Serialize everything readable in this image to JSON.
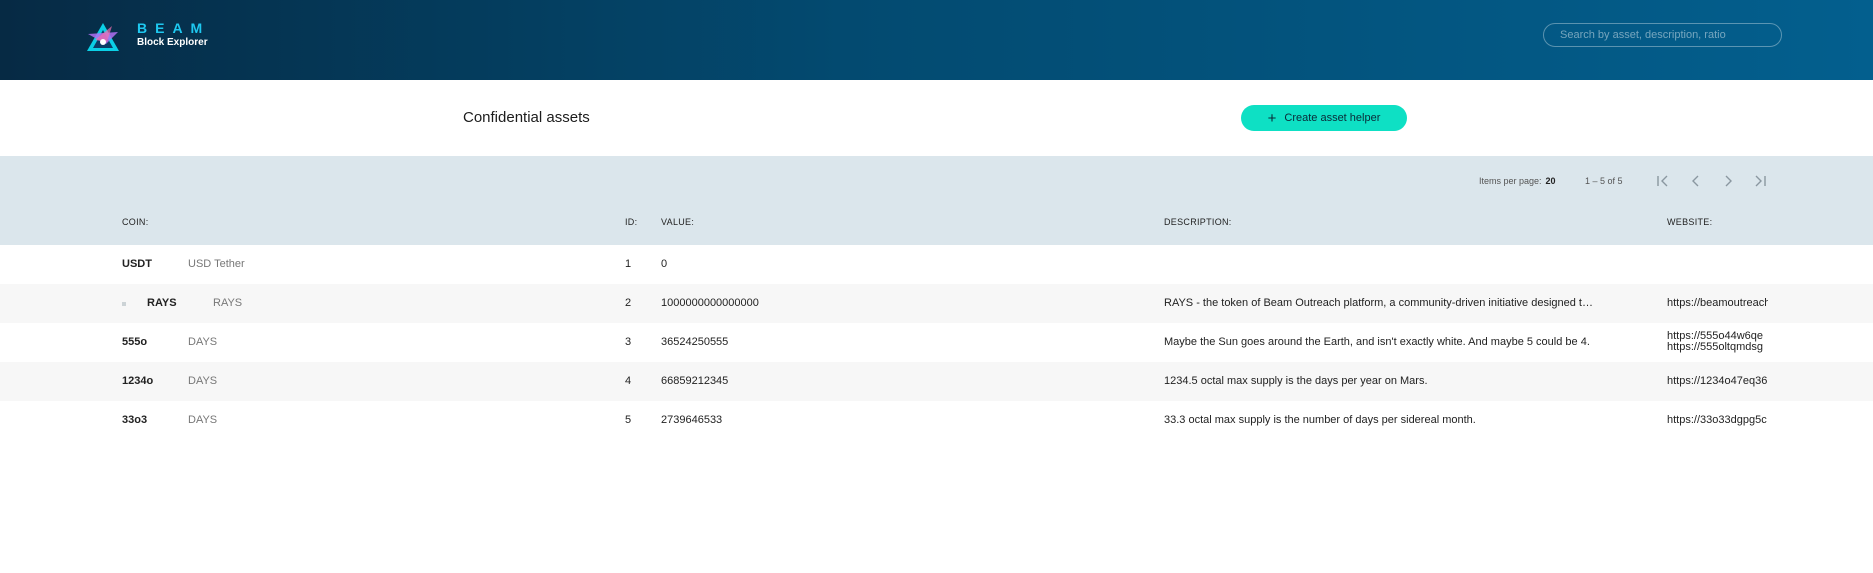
{
  "brand": {
    "name": "BEAM",
    "subtitle": "Block Explorer"
  },
  "search": {
    "placeholder": "Search by asset, description, ratio"
  },
  "page": {
    "title": "Confidential assets",
    "create_button": "Create asset helper"
  },
  "pagination": {
    "items_per_page_label": "Items per page:",
    "items_per_page": "20",
    "range": "1 – 5 of 5"
  },
  "columns": {
    "coin": "COIN:",
    "id": "ID:",
    "value": "VALUE:",
    "description": "DESCRIPTION:",
    "website": "WEBSITE:"
  },
  "rows": [
    {
      "coin": "USDT",
      "name": "USD Tether",
      "id": "1",
      "value": "0",
      "description": "",
      "website": ""
    },
    {
      "coin": "RAYS",
      "name": "RAYS",
      "id": "2",
      "value": "1000000000000000",
      "description": "RAYS - the token of Beam Outreach platform, a community-driven initiative designed to promote the Beam ecosystem",
      "website": "https://beamoutreach"
    },
    {
      "coin": "555o",
      "name": "DAYS",
      "id": "3",
      "value": "36524250555",
      "description": "Maybe the Sun goes around the Earth, and isn't exactly white. And maybe 5 could be 4.",
      "website": "https://555o44w6qe",
      "website2": "https://555oltqmdsg"
    },
    {
      "coin": "1234o",
      "name": "DAYS",
      "id": "4",
      "value": "66859212345",
      "description": "1234.5 octal max supply is the days per year on Mars.",
      "website": "https://1234o47eq36"
    },
    {
      "coin": "33o3",
      "name": "DAYS",
      "id": "5",
      "value": "2739646533",
      "description": "33.3 octal max supply is the number of days per sidereal month.",
      "website": "https://33o33dgpg5c"
    }
  ],
  "colors": {
    "accent": "#0ee0c4",
    "brand": "#1ec8f0",
    "header_dark": "#062a44",
    "header_light": "#035f8e",
    "table_head": "#dbe6ec"
  }
}
